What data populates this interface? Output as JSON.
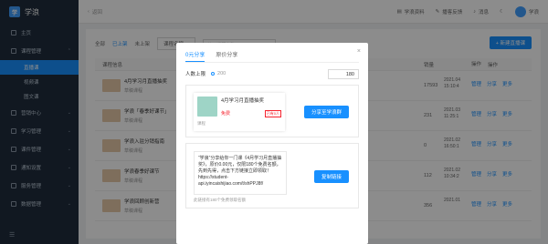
{
  "app": {
    "name": "学浪",
    "logo_char": "学"
  },
  "sidebar": {
    "items": [
      {
        "label": "主页"
      },
      {
        "label": "课程管理"
      },
      {
        "label": "直播课"
      },
      {
        "label": "视频课"
      },
      {
        "label": "图文课"
      },
      {
        "label": "营销中心"
      },
      {
        "label": "学习管理"
      },
      {
        "label": "课件管理"
      },
      {
        "label": "通知设置"
      },
      {
        "label": "服务管理"
      },
      {
        "label": "数据管理"
      }
    ],
    "collapse_icon": "collapse-icon"
  },
  "topbar": {
    "back_label": "返回",
    "links": [
      "学浪资料",
      "播客反馈",
      "消息"
    ],
    "user": "学浪"
  },
  "filters": {
    "tabs": [
      "全部",
      "已上架",
      "未上架"
    ],
    "select_label": "课程名称",
    "search_placeholder": "输入课程名称",
    "new_button": "+ 新建直播课"
  },
  "table": {
    "headers": {
      "info": "课程信息",
      "sales": "销量",
      "ops": "操作"
    },
    "rows": [
      {
        "title": "4月学习月直播抽奖",
        "status": "草稿课程",
        "sales": "17593",
        "amount": "",
        "date": "2021.04 15:10:4",
        "ops": [
          "管理",
          "分享",
          "更多"
        ]
      },
      {
        "title": "学浪「春季好课节」",
        "status": "草稿课程",
        "sales": "231",
        "amount": "",
        "date": "2021.03 11:25:1",
        "ops": [
          "管理",
          "分享",
          "更多"
        ]
      },
      {
        "title": "学浪入驻分销指南",
        "status": "草稿课程",
        "sales": "0",
        "amount": "",
        "date": "2021.02 16:50:1",
        "ops": [
          "管理",
          "分享",
          "更多"
        ]
      },
      {
        "title": "学浪春季好课节",
        "status": "草稿课程",
        "sales": "112",
        "amount": "",
        "date": "2021.02 10:34:2",
        "ops": [
          "管理",
          "分享",
          "更多"
        ]
      },
      {
        "title": "学浪回顾创新营",
        "status": "草稿课程",
        "sales": "356",
        "amount": "",
        "date": "2021.01",
        "ops": [
          "管理",
          "分享",
          "更多"
        ]
      }
    ]
  },
  "modal": {
    "tabs": [
      "0元分享",
      "原价分享"
    ],
    "people_label": "人数上限",
    "slider_value": "200",
    "people_value": "180",
    "card": {
      "title": "4月学习月直播抽奖",
      "price": "免费",
      "tag": "已有0人",
      "caption": "课程"
    },
    "share_button": "分享至学浪群",
    "share_text": "“学浪”分享给你一门课《4月学习月直播抽奖》，原价0.00元，仅限180个免费名额，先到先得，点击下方链接立即领取！ https://student-api.iyincaishijiao.com/t/shPPJ8f/",
    "copy_button": "复制链接",
    "help_text": "此链接有180个免费领取名额"
  }
}
